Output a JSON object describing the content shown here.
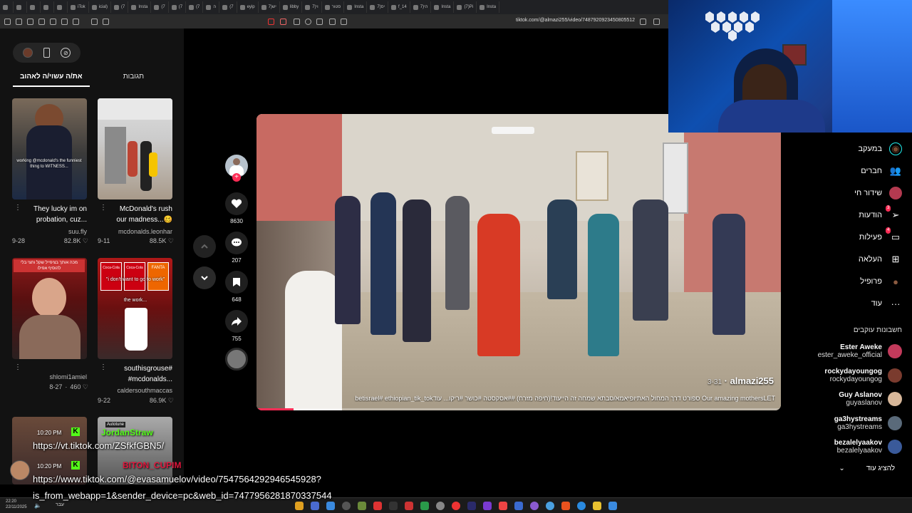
{
  "browser": {
    "tabs": [
      "",
      "",
      "",
      "",
      "",
      "iTok",
      "icial)",
      "(7",
      "Insta",
      "(7",
      "(7",
      "(7",
      "ה",
      "(7",
      "eyip",
      "יש(7",
      "libby",
      "וי(7",
      "סטור",
      "Insta",
      "יס(7",
      "f_14",
      "הי(7",
      "Insta",
      "(7)Pi",
      "Insta"
    ],
    "url": "tiktok.com/@almazi255/video/7487920923450805512"
  },
  "left_panel": {
    "tabs": {
      "liked": "תגובות",
      "you_may_like": "את/ה עשוי/ה לאהוב"
    },
    "cards": [
      {
        "title1": "They lucky im on",
        "title2": "probation, cuz...",
        "user": "suu.fly",
        "date": "9-28",
        "likes": "82.8K"
      },
      {
        "title1": "McDonald's rush",
        "title2": "our madness...🥴",
        "user": "mcdonalds.leonhar",
        "date": "9-11",
        "likes": "88.5K"
      },
      {
        "title1": "",
        "title2": "",
        "user": "shlomi1amiel",
        "date": "8-27",
        "likes": "460"
      },
      {
        "title1": "southisgrouse#",
        "title2": "#mcdonalds...",
        "user": "caldersouthmaccas",
        "date": "9-22",
        "likes": "86.9K"
      }
    ],
    "thumb_texts": {
      "t1": "working @mcdonald's the funniest thing to WITNESS...",
      "t2": "מכה אותך בציפייל שקל וחצי בלי להוסיף אפילו",
      "t3": "\"i don't want to go to work\"",
      "t4": "the work..."
    }
  },
  "actions": {
    "likes": "8630",
    "comments": "207",
    "saves": "648",
    "shares": "755"
  },
  "video": {
    "username": "almazi255",
    "date": "3-31",
    "caption": "Our amazing mothers‬‬LET ספורט דרך המחול האתיופיאמא/סבתא שמחה זה הייעוד!(חיפה מזרח) #betisrael#‬ ethiopian_tik_tok‪‫#אסקסטה #כושר #ריקו... עוד",
    "progress": 0.07
  },
  "right_nav": {
    "items": [
      {
        "label": "במעקב",
        "icon": "following-avatar-icon"
      },
      {
        "label": "חברים",
        "icon": "friends-icon"
      },
      {
        "label": "שידור חי",
        "icon": "live-icon"
      },
      {
        "label": "הודעות",
        "icon": "messages-icon",
        "badge": "3"
      },
      {
        "label": "פעילות",
        "icon": "activity-icon",
        "badge": "4"
      },
      {
        "label": "העלאה",
        "icon": "upload-icon"
      },
      {
        "label": "פרופיל",
        "icon": "profile-icon"
      },
      {
        "label": "עוד",
        "icon": "more-icon"
      }
    ],
    "following_header": "חשבונות עוקבים",
    "following": [
      {
        "name": "Ester Aweke",
        "handle": "ester_aweke_official",
        "color": "#c23a5b"
      },
      {
        "name": "rockydayoungog",
        "handle": "rockydayoungog",
        "color": "#7a3b2e"
      },
      {
        "name": "Guy Aslanov",
        "handle": "guyaslanov",
        "color": "#d7b79a"
      },
      {
        "name": "ga3hystreams",
        "handle": "ga3hystreams",
        "color": "#5a6a7a"
      },
      {
        "name": "bezalelyaakov",
        "handle": "bezalelyaakov",
        "color": "#3a5a9a"
      }
    ],
    "show_more": "להציג עוד"
  },
  "chat": [
    {
      "time": "10:20 PM",
      "user": "JordanStraw",
      "badge": "Autotune",
      "text": "https://vt.tiktok.com/ZSfkfGBN5/"
    },
    {
      "time": "10:20 PM",
      "user": "BITON_CUPIM",
      "text": "https://www.tiktok.com/@evasamuelov/video/7547564292946545928?",
      "text2": "is_from_webapp=1&sender_device=pc&web_id=7477956281870337544"
    }
  ],
  "taskbar": {
    "time": "22:20",
    "date": "22/11/2025",
    "lang": "עבר"
  },
  "colors": {
    "accent": "#fe2c55",
    "bg": "#121212",
    "kick_green": "#53fc18"
  }
}
